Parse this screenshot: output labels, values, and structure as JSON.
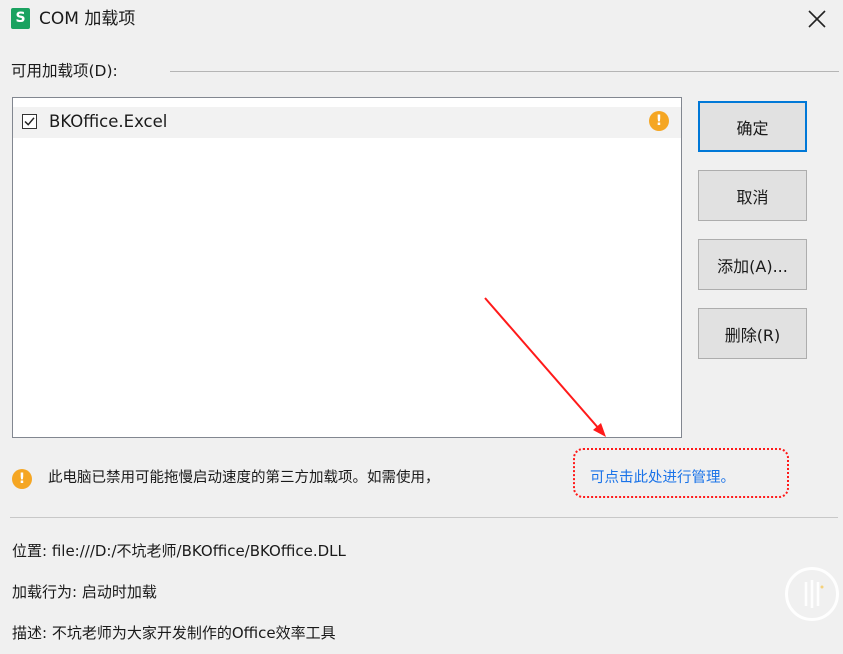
{
  "window": {
    "app_icon_letter": "S",
    "title": "COM 加载项",
    "close_icon": "close-icon"
  },
  "addins_group": {
    "label": "可用加载项(D):",
    "items": [
      {
        "name": "BKOffice.Excel",
        "checked": true,
        "warning": "!"
      }
    ]
  },
  "buttons": {
    "ok": "确定",
    "cancel": "取消",
    "add": "添加(A)...",
    "remove": "删除(R)"
  },
  "notice": {
    "icon": "!",
    "text": "此电脑已禁用可能拖慢启动速度的第三方加载项。如需使用，",
    "link": "可点击此处进行管理。"
  },
  "details": {
    "location": "位置: file:///D:/不坑老师/BKOffice/BKOffice.DLL",
    "load_behavior": "加载行为: 启动时加载",
    "description": "描述: 不坑老师为大家开发制作的Office效率工具"
  },
  "colors": {
    "app_icon": "#1aa260",
    "warning": "#f5a623",
    "link": "#1a73e8",
    "annotation": "#ff1a1a",
    "default_button_border": "#0078d7"
  }
}
